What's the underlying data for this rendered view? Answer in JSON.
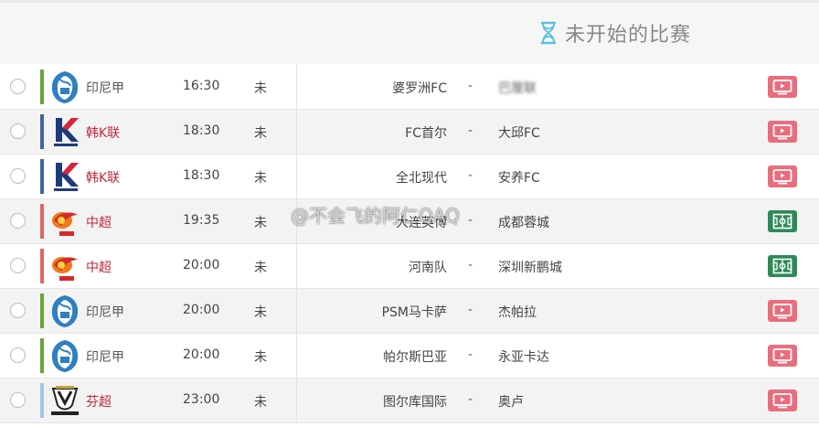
{
  "header": {
    "title": "未开始的比赛",
    "icon": "hourglass-icon",
    "accent": "#5bc0de"
  },
  "matches": [
    {
      "league": "印尼甲",
      "league_kind": "indo",
      "time": "16:30",
      "status": "未",
      "home": "婆罗洲FC",
      "away": "巴厘联",
      "away_blurred": true,
      "action": "live-stream",
      "action_icon": "tv-icon"
    },
    {
      "league": "韩K联",
      "league_kind": "kleague",
      "time": "18:30",
      "status": "未",
      "home": "FC首尔",
      "away": "大邱FC",
      "away_blurred": false,
      "action": "live-stream",
      "action_icon": "tv-icon"
    },
    {
      "league": "韩K联",
      "league_kind": "kleague",
      "time": "18:30",
      "status": "未",
      "home": "全北现代",
      "away": "安养FC",
      "away_blurred": false,
      "action": "live-stream",
      "action_icon": "tv-icon"
    },
    {
      "league": "中超",
      "league_kind": "csl",
      "time": "19:35",
      "status": "未",
      "home": "大连英博",
      "away": "成都蓉城",
      "away_blurred": false,
      "action": "animation",
      "action_icon": "pitch-icon"
    },
    {
      "league": "中超",
      "league_kind": "csl",
      "time": "20:00",
      "status": "未",
      "home": "河南队",
      "away": "深圳新鹏城",
      "away_blurred": false,
      "action": "animation",
      "action_icon": "pitch-icon"
    },
    {
      "league": "印尼甲",
      "league_kind": "indo",
      "time": "20:00",
      "status": "未",
      "home": "PSM马卡萨",
      "away": "杰帕拉",
      "away_blurred": false,
      "action": "live-stream",
      "action_icon": "tv-icon"
    },
    {
      "league": "印尼甲",
      "league_kind": "indo",
      "time": "20:00",
      "status": "未",
      "home": "帕尔斯巴亚",
      "away": "永亚卡达",
      "away_blurred": false,
      "action": "live-stream",
      "action_icon": "tv-icon"
    },
    {
      "league": "芬超",
      "league_kind": "finland",
      "time": "23:00",
      "status": "未",
      "home": "图尔库国际",
      "away": "奥卢",
      "away_blurred": false,
      "action": "live-stream",
      "action_icon": "tv-icon"
    }
  ],
  "league_styles": {
    "indo": {
      "bar": "#6aa436",
      "text": "#555555",
      "logo_text": "LIGA 1"
    },
    "kleague": {
      "bar": "#3f63a6",
      "text": "#c0283e",
      "logo_text": "K LEAGUE 1"
    },
    "csl": {
      "bar": "#e06666",
      "text": "#c0283e",
      "logo_text": "CSL"
    },
    "finland": {
      "bar": "#a9c4ea",
      "text": "#c0283e",
      "logo_text": "VEIKKAUSLIIGA"
    }
  },
  "action_colors": {
    "live-stream": "#ea6d7d",
    "animation": "#2d8a57"
  },
  "watermark": "@不会飞的阿仁QAQ"
}
